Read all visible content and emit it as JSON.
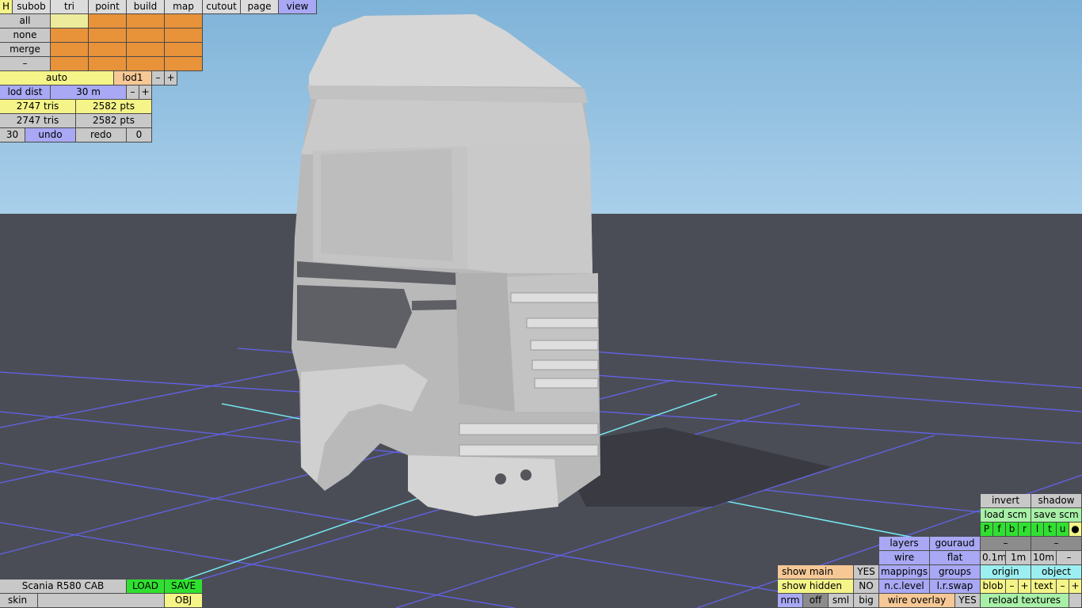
{
  "toolbar": {
    "h": "H",
    "tabs": [
      "subob",
      "tri",
      "point",
      "build",
      "map",
      "cutout",
      "page",
      "view"
    ]
  },
  "select_rows": [
    "all",
    "none",
    "merge",
    "–"
  ],
  "lod": {
    "auto": "auto",
    "lod1": "lod1",
    "minus": "–",
    "plus": "+"
  },
  "lod_dist": {
    "label": "lod dist",
    "value": "30 m",
    "minus": "–",
    "plus": "+"
  },
  "stats": [
    {
      "tris": "2747 tris",
      "pts": "2582 pts"
    },
    {
      "tris": "2747 tris",
      "pts": "2582 pts"
    }
  ],
  "undo_row": {
    "count": "30",
    "undo": "undo",
    "redo": "redo",
    "redo_count": "0"
  },
  "bottom_left": {
    "name": "Scania R580 CAB",
    "load": "LOAD",
    "save": "SAVE",
    "skin": "skin",
    "obj": "OBJ"
  },
  "right_panel": {
    "invert": "invert",
    "shadow": "shadow",
    "load_scm": "load scm",
    "save_scm": "save scm",
    "flags": [
      "P",
      "f",
      "b",
      "r",
      "l",
      "t",
      "u",
      "●"
    ],
    "layers": "layers",
    "gouraud": "gouraud",
    "dash1": "–",
    "dash2": "–",
    "wire": "wire",
    "flat": "flat",
    "s01": "0.1m",
    "s1": "1m",
    "s10": "10m",
    "sminus": "–",
    "show_main": "show main",
    "show_main_val": "YES",
    "mappings": "mappings",
    "groups": "groups",
    "origin": "origin",
    "object": "object",
    "show_hidden": "show hidden",
    "show_hidden_val": "NO",
    "nclevel": "n.c.level",
    "lrswap": "l.r.swap",
    "blob": "blob",
    "blob_minus": "–",
    "blob_plus": "+",
    "text": "text",
    "text_minus": "–",
    "text_plus": "+",
    "nrm": "nrm",
    "off": "off",
    "sml": "sml",
    "big": "big",
    "wire_overlay": "wire overlay",
    "wire_overlay_val": "YES",
    "reload": "reload textures"
  },
  "colors": {
    "sky_top": "#7fb3d8",
    "sky_bottom": "#a9cfea",
    "floor": "#4b4d56",
    "grid": "#6a6af0",
    "axis": "#74e6ee"
  }
}
